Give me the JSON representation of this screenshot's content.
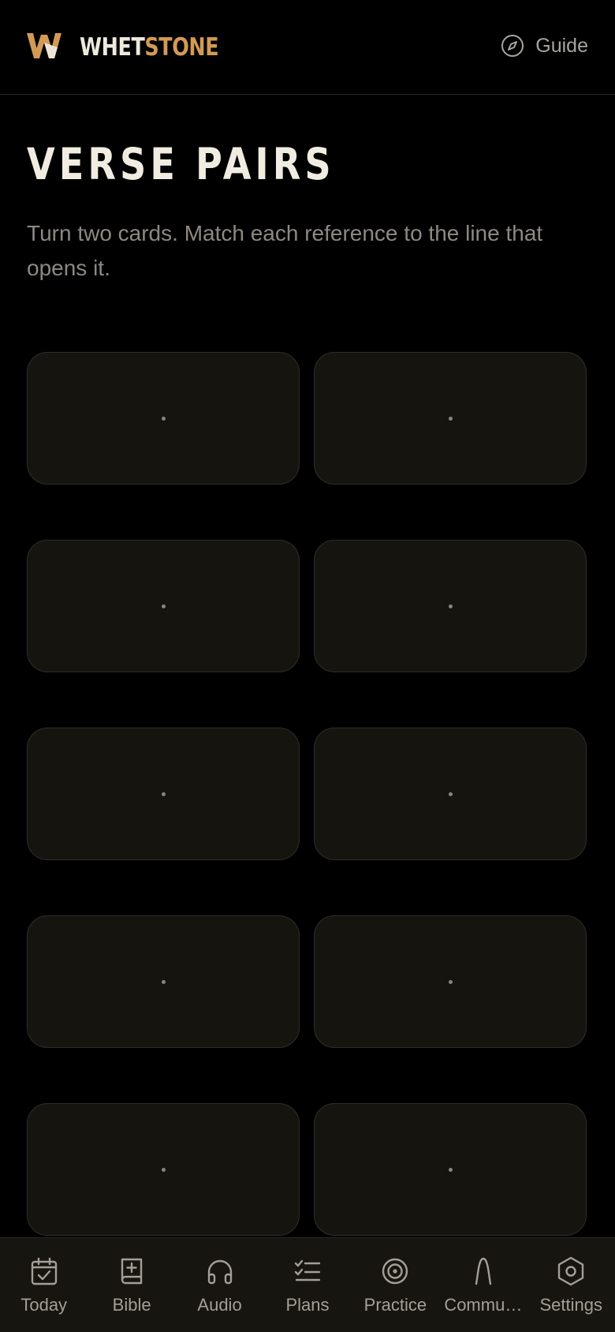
{
  "colors": {
    "background": "#000000",
    "accent": "#d39a55",
    "card_bg": "#16140f",
    "card_border": "#2f2d2a",
    "text_primary": "#f1ece1",
    "text_secondary": "#8d8982"
  },
  "header": {
    "brand_part1": "WHET",
    "brand_part2": "STONE",
    "logo_icon": "w-logo-icon",
    "guide_label": "Guide",
    "guide_icon": "compass-icon"
  },
  "page": {
    "title": "VERSE PAIRS",
    "subtitle": "Turn two cards. Match each reference to the line that opens it."
  },
  "cards": {
    "count": 10,
    "state": "face-down"
  },
  "tabbar": {
    "items": [
      {
        "label": "Today",
        "icon": "calendar-check-icon"
      },
      {
        "label": "Bible",
        "icon": "book-plus-icon"
      },
      {
        "label": "Audio",
        "icon": "headphones-icon"
      },
      {
        "label": "Plans",
        "icon": "checklist-icon"
      },
      {
        "label": "Practice",
        "icon": "target-icon"
      },
      {
        "label": "Commu…",
        "icon": "arch-icon"
      },
      {
        "label": "Settings",
        "icon": "hexagon-settings-icon"
      }
    ]
  }
}
